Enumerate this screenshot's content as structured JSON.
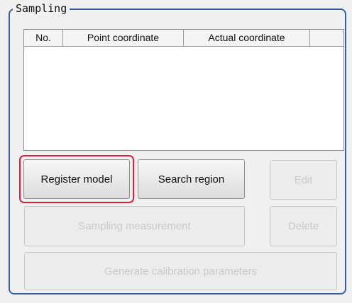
{
  "group": {
    "title": "Sampling"
  },
  "table": {
    "columns": [
      "No.",
      "Point coordinate",
      "Actual coordinate",
      ""
    ],
    "rows": []
  },
  "buttons": {
    "register_model": "Register model",
    "search_region": "Search region",
    "edit": "Edit",
    "sampling_measurement": "Sampling measurement",
    "delete": "Delete",
    "generate_calibration": "Generate calibration parameters"
  },
  "colors": {
    "group_border": "#3a5fa8",
    "highlight": "#d9213b",
    "disabled_text": "#c9c9c9"
  }
}
